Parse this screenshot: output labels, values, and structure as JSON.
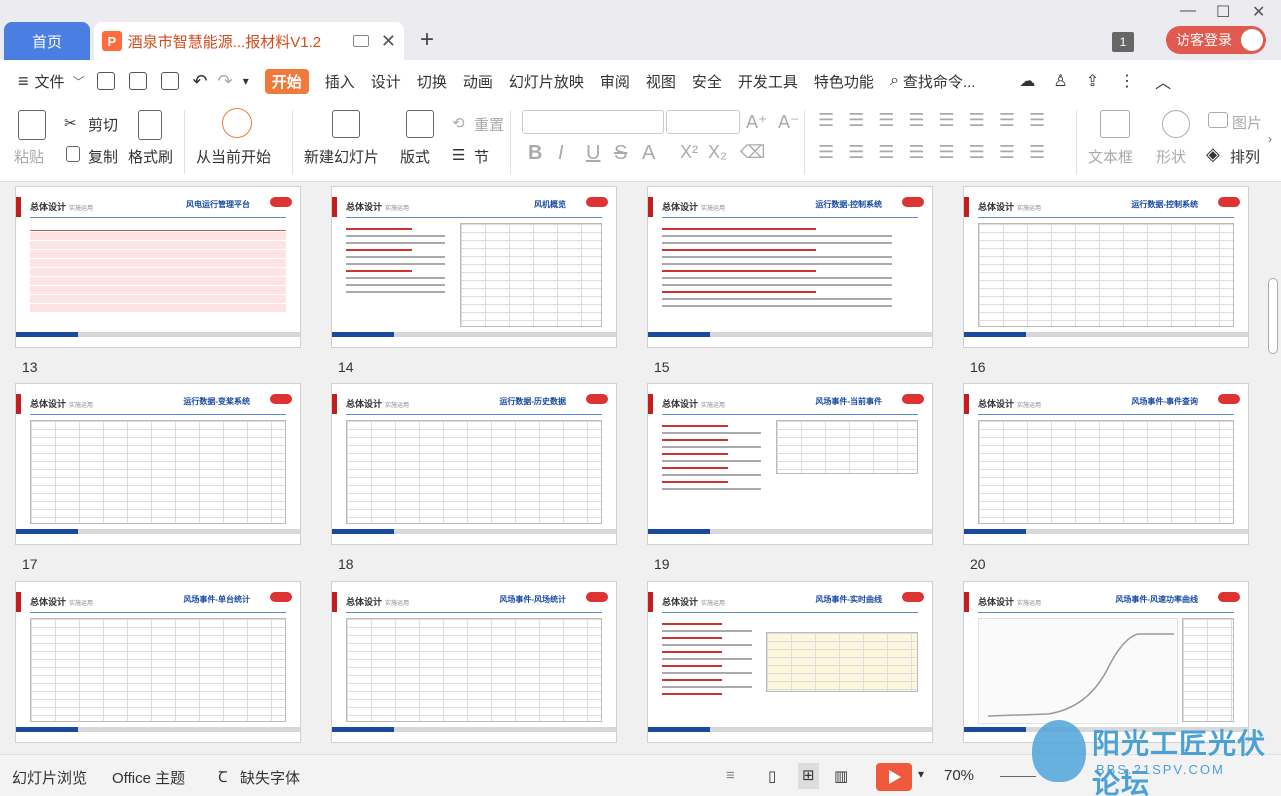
{
  "tabs": {
    "home": "首页",
    "doc": "酒泉市智慧能源...报材料V1.2",
    "doc_icon": "P"
  },
  "window": {
    "count_badge": "1",
    "login": "访客登录"
  },
  "menu": {
    "file": "文件",
    "items": [
      "开始",
      "插入",
      "设计",
      "切换",
      "动画",
      "幻灯片放映",
      "审阅",
      "视图",
      "安全",
      "开发工具",
      "特色功能"
    ],
    "search": "查找命令..."
  },
  "ribbon": {
    "paste": "粘贴",
    "cut": "剪切",
    "copy": "复制",
    "format_painter": "格式刷",
    "from_current": "从当前开始",
    "new_slide": "新建幻灯片",
    "layout": "版式",
    "reset": "重置",
    "section": "节",
    "textbox": "文本框",
    "shape": "形状",
    "picture": "图片",
    "arrange": "排列"
  },
  "slides": [
    {
      "num": "13",
      "title": "风电运行管理平台",
      "kind": "table"
    },
    {
      "num": "14",
      "title": "风机概览",
      "kind": "text-grid"
    },
    {
      "num": "15",
      "title": "运行数据-控制系统",
      "kind": "text"
    },
    {
      "num": "16",
      "title": "运行数据-控制系统",
      "kind": "grid"
    },
    {
      "num": "17",
      "title": "运行数据-变桨系统",
      "kind": "grid"
    },
    {
      "num": "18",
      "title": "运行数据-历史数据",
      "kind": "grid"
    },
    {
      "num": "19",
      "title": "风场事件-当前事件",
      "kind": "text-grid"
    },
    {
      "num": "20",
      "title": "风场事件-事件查询",
      "kind": "grid"
    },
    {
      "num": "",
      "title": "风场事件-单台统计",
      "kind": "grid"
    },
    {
      "num": "",
      "title": "风场事件-风场统计",
      "kind": "grid"
    },
    {
      "num": "",
      "title": "风场事件-实时曲线",
      "kind": "text-grid"
    },
    {
      "num": "",
      "title": "风场事件-风速功率曲线",
      "kind": "chart"
    }
  ],
  "slide_header": {
    "main": "总体设计",
    "sub": "实施运用"
  },
  "status": {
    "slide_browse": "幻灯片浏览",
    "office_theme": "Office 主题",
    "missing_font": "缺失字体",
    "zoom": "70%"
  },
  "watermark": {
    "line1": "阳光工匠光伏论坛",
    "line2": "BBS.21SPV.COM"
  },
  "colors": {
    "accent": "#f07a3c",
    "home_tab": "#4a7ee0",
    "slide_red": "#c31d1d",
    "slide_blue": "#1a4aa0"
  }
}
